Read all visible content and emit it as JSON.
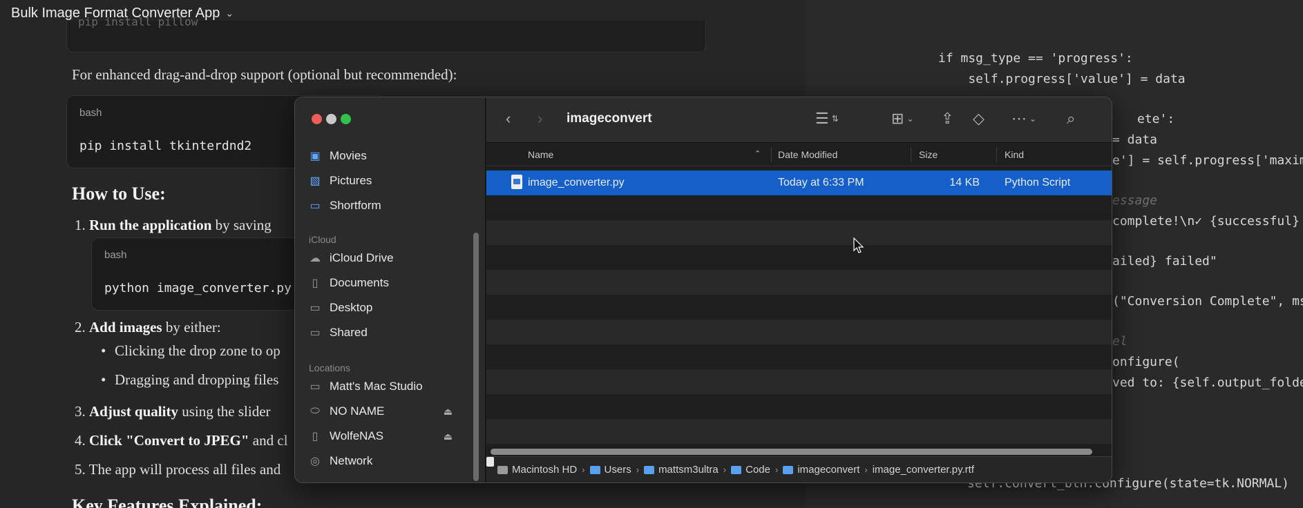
{
  "doc": {
    "title": "Bulk Image Format Converter App",
    "cut_code": "pip install pillow",
    "optional_text": "For enhanced drag-and-drop support (optional but recommended):",
    "code1_lang": "bash",
    "code1": "pip install tkinterdnd2",
    "how_to_heading": "How to Use:",
    "step1_bold": "Run the application",
    "step1_rest": " by saving",
    "code2_lang": "bash",
    "code2": "python image_converter.py",
    "step2_bold": "Add images",
    "step2_rest": " by either:",
    "bullet1": "Clicking the drop zone to op",
    "bullet2": "Dragging and dropping files",
    "step3_bold": "Adjust quality",
    "step3_rest": " using the slider",
    "step4_bold": "Click \"Convert to JPEG\"",
    "step4_rest": " and cl",
    "step5": "The app will process all files and",
    "key_heading": "Key Features Explained:"
  },
  "code_lines": [
    "if msg_type == 'progress':",
    "    self.progress['value'] = data",
    "ete':",
    "= data",
    "e'] = self.progress['maxim",
    "essage",
    "complete!\\n✓ {successful}",
    "ailed} failed\"",
    "(\"Conversion Complete\", ms",
    "el",
    "onfigure(",
    "ved to: {self.output_folde",
    "self.convert_btn.configure(state=tk.NORMAL)"
  ],
  "finder": {
    "folder_title": "imageconvert",
    "sidebar": {
      "favorites": [
        {
          "label": "Movies",
          "icon": "film-icon"
        },
        {
          "label": "Pictures",
          "icon": "photo-icon"
        },
        {
          "label": "Shortform",
          "icon": "folder-icon"
        }
      ],
      "icloud_heading": "iCloud",
      "icloud": [
        {
          "label": "iCloud Drive",
          "icon": "cloud-icon"
        },
        {
          "label": "Documents",
          "icon": "document-icon"
        },
        {
          "label": "Desktop",
          "icon": "desktop-icon"
        },
        {
          "label": "Shared",
          "icon": "shared-folder-icon"
        }
      ],
      "locations_heading": "Locations",
      "locations": [
        {
          "label": "Matt's Mac Studio",
          "icon": "computer-icon",
          "eject": false
        },
        {
          "label": "NO NAME",
          "icon": "drive-icon",
          "eject": true
        },
        {
          "label": "WolfeNAS",
          "icon": "document-icon",
          "eject": true
        },
        {
          "label": "Network",
          "icon": "globe-icon",
          "eject": false
        }
      ]
    },
    "columns": {
      "name": "Name",
      "date": "Date Modified",
      "size": "Size",
      "kind": "Kind"
    },
    "files": [
      {
        "name": "image_converter.py",
        "date": "Today at 6:33 PM",
        "size": "14 KB",
        "kind": "Python Script"
      }
    ],
    "path": [
      "Macintosh HD",
      "Users",
      "mattsm3ultra",
      "Code",
      "imageconvert",
      "image_converter.py.rtf"
    ]
  }
}
